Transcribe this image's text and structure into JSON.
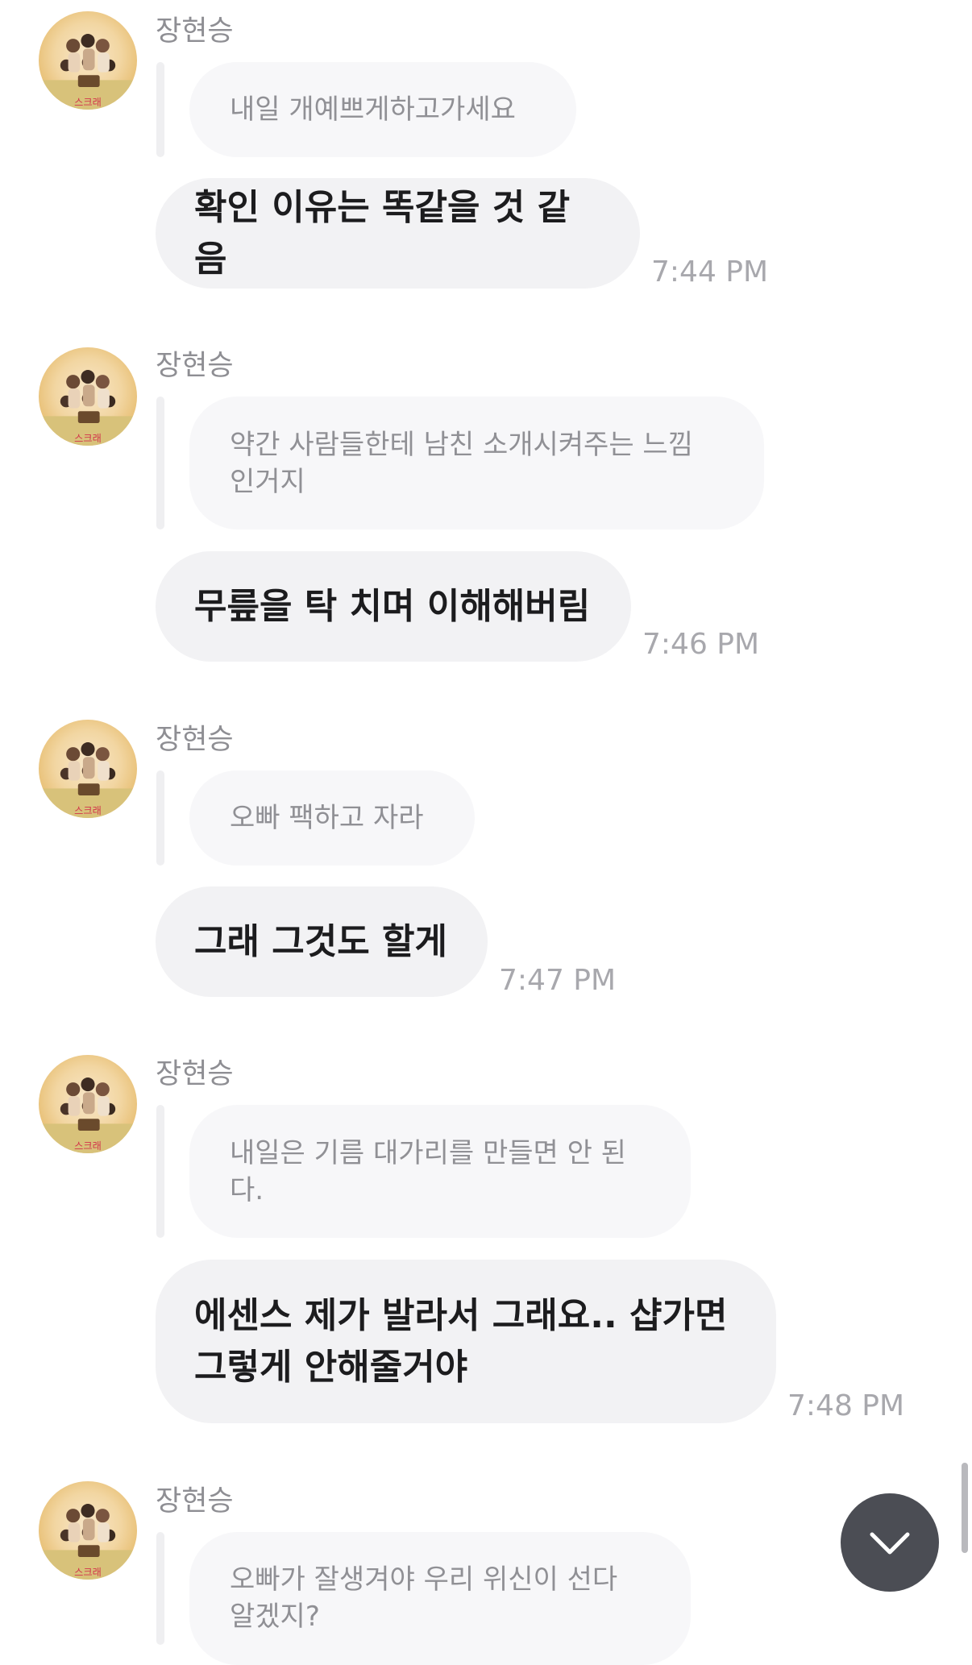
{
  "messages": [
    {
      "sender": "장현승",
      "quote": "내일 개예쁘게하고가세요",
      "text": "확인 이유는 똑같을 것 같음",
      "time": "7:44 PM"
    },
    {
      "sender": "장현승",
      "quote": "약간 사람들한테 남친 소개시켜주는 느낌\n인거지",
      "text": "무릎을 탁 치며 이해해버림",
      "time": "7:46 PM"
    },
    {
      "sender": "장현승",
      "quote": "오빠 팩하고 자라",
      "text": "그래 그것도 할게",
      "time": "7:47 PM"
    },
    {
      "sender": "장현승",
      "quote": "내일은 기름 대가리를 만들면 안 된\n다.",
      "text": "에센스 제가 발라서 그래요.. 샵가면\n그렇게 안해줄거야",
      "time": "7:48 PM"
    },
    {
      "sender": "장현승",
      "quote": "오빠가 잘생겨야 우리 위신이 선다\n알겠지?"
    }
  ],
  "icons": {
    "avatar": "group-photo-avatar",
    "scroll_down": "chevron-down-icon"
  },
  "colors": {
    "bubble": "#f2f2f4",
    "quote_bubble": "#f7f7f9",
    "time": "#a8a8ad",
    "scroll_button": "#4b4d54"
  }
}
